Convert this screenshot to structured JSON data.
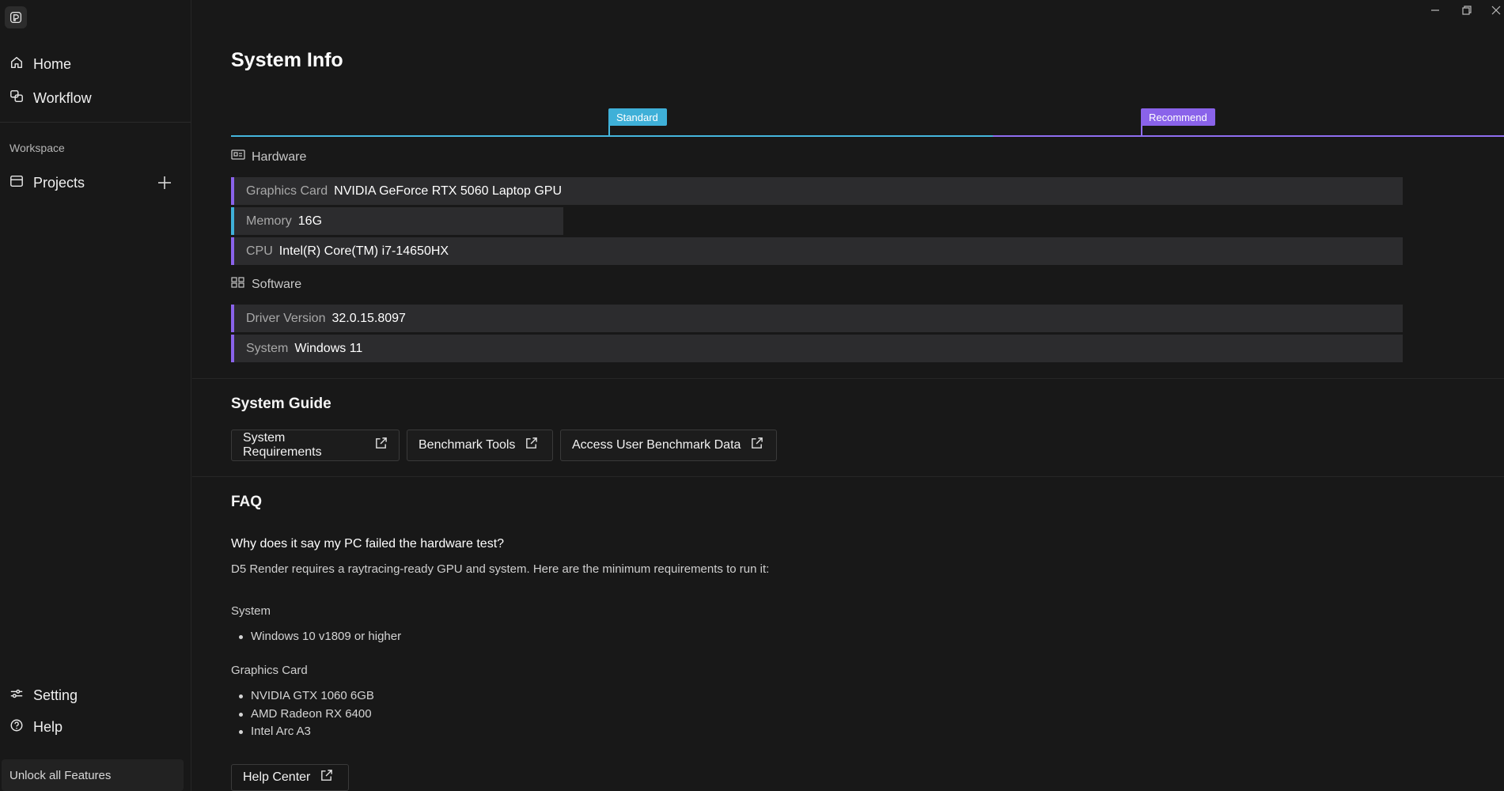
{
  "sidebar": {
    "nav": [
      {
        "label": "Home",
        "icon": "home-icon"
      },
      {
        "label": "Workflow",
        "icon": "workflow-icon"
      }
    ],
    "workspace_label": "Workspace",
    "projects_label": "Projects",
    "bottom": [
      {
        "label": "Setting",
        "icon": "sliders-icon"
      },
      {
        "label": "Help",
        "icon": "help-circle-icon"
      }
    ],
    "unlock_label": "Unlock all Features"
  },
  "main": {
    "title": "System Info",
    "tiers": {
      "standard": "Standard",
      "recommend": "Recommend"
    },
    "colors": {
      "standard": "#3fb0d8",
      "recommend": "#8a63ea"
    },
    "hardware": {
      "heading": "Hardware",
      "rows": [
        {
          "key": "Graphics Card",
          "value": "NVIDIA GeForce RTX 5060 Laptop GPU",
          "tier": "recommend"
        },
        {
          "key": "Memory",
          "value": "16G",
          "tier": "standard"
        },
        {
          "key": "CPU",
          "value": "Intel(R) Core(TM) i7-14650HX",
          "tier": "recommend"
        }
      ]
    },
    "software": {
      "heading": "Software",
      "rows": [
        {
          "key": "Driver Version",
          "value": "32.0.15.8097",
          "tier": "recommend"
        },
        {
          "key": "System",
          "value": "Windows 11",
          "tier": "recommend"
        }
      ]
    },
    "guide": {
      "heading": "System Guide",
      "buttons": [
        "System Requirements",
        "Benchmark Tools",
        "Access User Benchmark Data"
      ]
    },
    "faq": {
      "heading": "FAQ",
      "question": "Why does it say my PC failed the hardware test?",
      "answer": "D5 Render requires a raytracing-ready GPU and system. Here are the minimum requirements to run it:",
      "system_label": "System",
      "system_items": [
        "Windows 10 v1809 or higher"
      ],
      "gpu_label": "Graphics Card",
      "gpu_items": [
        "NVIDIA GTX 1060 6GB",
        "AMD Radeon RX 6400",
        "Intel Arc A3"
      ],
      "help_button": "Help Center"
    }
  }
}
